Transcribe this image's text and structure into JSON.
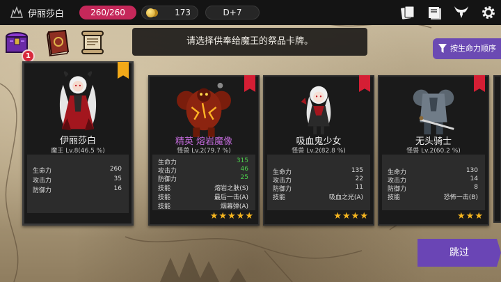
{
  "topbar": {
    "player_name": "伊丽莎白",
    "hp": "260/260",
    "gold": "173",
    "day": "D+7",
    "icons": [
      "castle-logo-icon",
      "card-deck-icon",
      "book-icon",
      "demon-horns-icon",
      "gear-icon"
    ]
  },
  "left_icons": {
    "icons": [
      "chest-icon",
      "spellbook-icon",
      "scroll-icon"
    ],
    "chest_badge": "1"
  },
  "prompt": "请选择供奉给魔王的祭品卡牌。",
  "sort_button": "按生命力顺序",
  "skip_button": "跳过",
  "cards": [
    {
      "name": "伊丽莎白",
      "elite": false,
      "level": "魔王 Lv.8(46.5 %)",
      "tag": "skull-tag",
      "stats": [
        {
          "k": "生命力",
          "v": "260"
        },
        {
          "k": "攻击力",
          "v": "35"
        },
        {
          "k": "防御力",
          "v": "16"
        }
      ],
      "skills": [],
      "stars": ""
    },
    {
      "name": "精英 熔岩魔像",
      "elite": true,
      "level": "怪兽 Lv.2(79.7 %)",
      "tag": "sword-tag",
      "stats": [
        {
          "k": "生命力",
          "v": "315"
        },
        {
          "k": "攻击力",
          "v": "46"
        },
        {
          "k": "防御力",
          "v": "25"
        }
      ],
      "skills": [
        {
          "k": "技能",
          "v": "熔岩之肤(S)"
        },
        {
          "k": "技能",
          "v": "最后一击(A)"
        },
        {
          "k": "技能",
          "v": "烟幕弹(A)"
        }
      ],
      "stars": "★★★★★"
    },
    {
      "name": "吸血鬼少女",
      "elite": false,
      "level": "怪兽 Lv.2(82.8 %)",
      "tag": "sword-tag",
      "stats": [
        {
          "k": "生命力",
          "v": "135"
        },
        {
          "k": "攻击力",
          "v": "22"
        },
        {
          "k": "防御力",
          "v": "11"
        }
      ],
      "skills": [
        {
          "k": "技能",
          "v": "吸血之光(A)"
        }
      ],
      "stars": "★★★★"
    },
    {
      "name": "无头骑士",
      "elite": false,
      "level": "怪兽 Lv.2(60.2 %)",
      "tag": "sword-tag",
      "stats": [
        {
          "k": "生命力",
          "v": "130"
        },
        {
          "k": "攻击力",
          "v": "14"
        },
        {
          "k": "防御力",
          "v": "8"
        }
      ],
      "skills": [
        {
          "k": "技能",
          "v": "恐怖一击(B)"
        }
      ],
      "stars": "★★★"
    }
  ],
  "colors": {
    "hp_pill": "#c5285a",
    "accent_purple": "#6a45b5",
    "elite_name": "#c06ad8",
    "stat_green": "#4cd04c",
    "star": "#f5b51f"
  }
}
